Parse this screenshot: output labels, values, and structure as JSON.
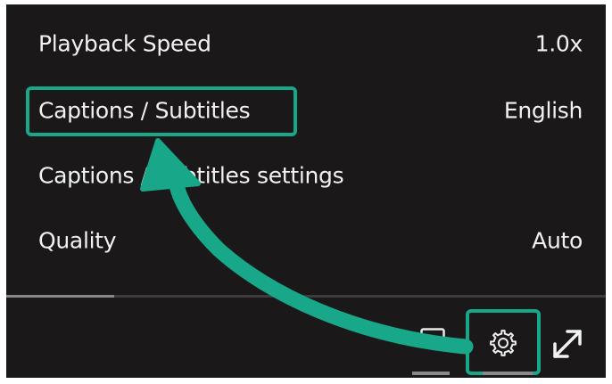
{
  "menu": {
    "items": [
      {
        "label": "Playback Speed",
        "value": "1.0x"
      },
      {
        "label": "Captions / Subtitles",
        "value": "English"
      },
      {
        "label": "Captions / Subtitles settings",
        "value": ""
      },
      {
        "label": "Quality",
        "value": "Auto"
      }
    ],
    "highlighted_item": "Captions / Subtitles"
  },
  "player": {
    "progress_fraction": 0.18
  },
  "controls": {
    "icons": [
      "captions-icon",
      "gear-icon",
      "fullscreen-icon"
    ],
    "highlighted_control": "gear-icon"
  },
  "annotation": {
    "highlight_color": "#18a889",
    "arrow_color": "#18a889"
  },
  "colors": {
    "menu_background": "#1a1818",
    "menu_text": "#f1f1f1"
  }
}
